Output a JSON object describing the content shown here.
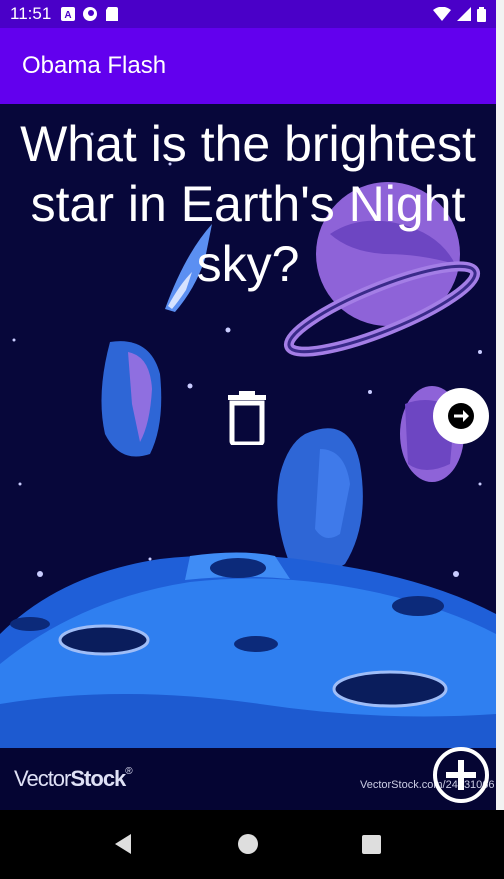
{
  "status_bar": {
    "time": "11:51",
    "icons": [
      "a-notification-icon",
      "circle-app-icon",
      "sd-card-icon",
      "wifi-icon",
      "signal-icon",
      "battery-icon"
    ]
  },
  "app_bar": {
    "title": "Obama Flash"
  },
  "card": {
    "question": "What is the brightest star in Earth's Night sky?"
  },
  "footer": {
    "logo_main": "Vector",
    "logo_bold": "Stock",
    "logo_mark": "®",
    "url": "VectorStock.com/24631066"
  },
  "colors": {
    "status_bar": "#4a00c8",
    "app_bar": "#6200ee",
    "space_bg": "#07073a",
    "planet_purple": "#8e63d8",
    "moon_blue": "#2f7ff0"
  }
}
